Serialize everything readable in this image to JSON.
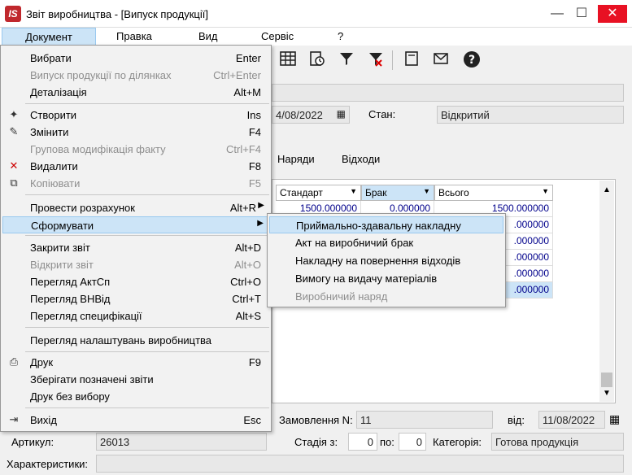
{
  "window": {
    "title": "Звіт виробництва - [Випуск продукції]",
    "minimize": "—",
    "maximize": "☐",
    "close": "✕"
  },
  "menubar": [
    "Документ",
    "Правка",
    "Вид",
    "Сервіс",
    "?"
  ],
  "menu": {
    "items": [
      {
        "label": "Вибрати",
        "shortcut": "Enter"
      },
      {
        "label": "Випуск продукції по ділянках",
        "shortcut": "Ctrl+Enter"
      },
      {
        "label": "Деталізація",
        "shortcut": "Alt+M"
      },
      {
        "label": "Створити",
        "shortcut": "Ins"
      },
      {
        "label": "Змінити",
        "shortcut": "F4"
      },
      {
        "label": "Групова модифікація факту",
        "shortcut": "Ctrl+F4"
      },
      {
        "label": "Видалити",
        "shortcut": "F8"
      },
      {
        "label": "Копіювати",
        "shortcut": "F5"
      },
      {
        "label": "Провести розрахунок",
        "shortcut": "Alt+R"
      },
      {
        "label": "Сформувати",
        "shortcut": ""
      },
      {
        "label": "Закрити звіт",
        "shortcut": "Alt+D"
      },
      {
        "label": "Відкрити звіт",
        "shortcut": "Alt+O"
      },
      {
        "label": "Перегляд АктСп",
        "shortcut": "Ctrl+O"
      },
      {
        "label": "Перегляд ВНВід",
        "shortcut": "Ctrl+T"
      },
      {
        "label": "Перегляд специфікації",
        "shortcut": "Alt+S"
      },
      {
        "label": "Перегляд налаштувань виробництва",
        "shortcut": ""
      },
      {
        "label": "Друк",
        "shortcut": "F9"
      },
      {
        "label": "Зберігати позначені звіти",
        "shortcut": ""
      },
      {
        "label": "Друк без вибору",
        "shortcut": ""
      },
      {
        "label": "Вихід",
        "shortcut": "Esc"
      }
    ]
  },
  "submenu": {
    "items": [
      "Приймально-здавальну накладну",
      "Акт на виробничий брак",
      "Накладну на повернення відходів",
      "Вимогу на видачу матеріалів",
      "Виробничий наряд"
    ]
  },
  "form": {
    "date_fragment": "4/08/2022",
    "state_label": "Стан:",
    "state_value": "Відкритий",
    "order_label": "Замовлення N:",
    "order_value": "11",
    "from_label": "від:",
    "from_value": "11/08/2022",
    "article_label": "Артикул:",
    "article_value": "26013",
    "stage_label": "Стадія з:",
    "stage_from": "0",
    "stage_to_label": "по:",
    "stage_to": "0",
    "category_label": "Категорія:",
    "category_value": "Готова продукція",
    "characteristics_label": "Характеристики:"
  },
  "tabs": [
    "Наряди",
    "Відходи"
  ],
  "grid": {
    "columns": [
      "Стандарт",
      "Брак",
      "Всього"
    ],
    "row1": [
      "1500.000000",
      "0.000000",
      "1500.000000"
    ],
    "partial_value": ".000000"
  },
  "toolbar_icons": [
    "table-icon",
    "clock-document-icon",
    "filter-icon",
    "clear-filter-icon",
    "document-icon",
    "mail-icon",
    "help-icon"
  ]
}
